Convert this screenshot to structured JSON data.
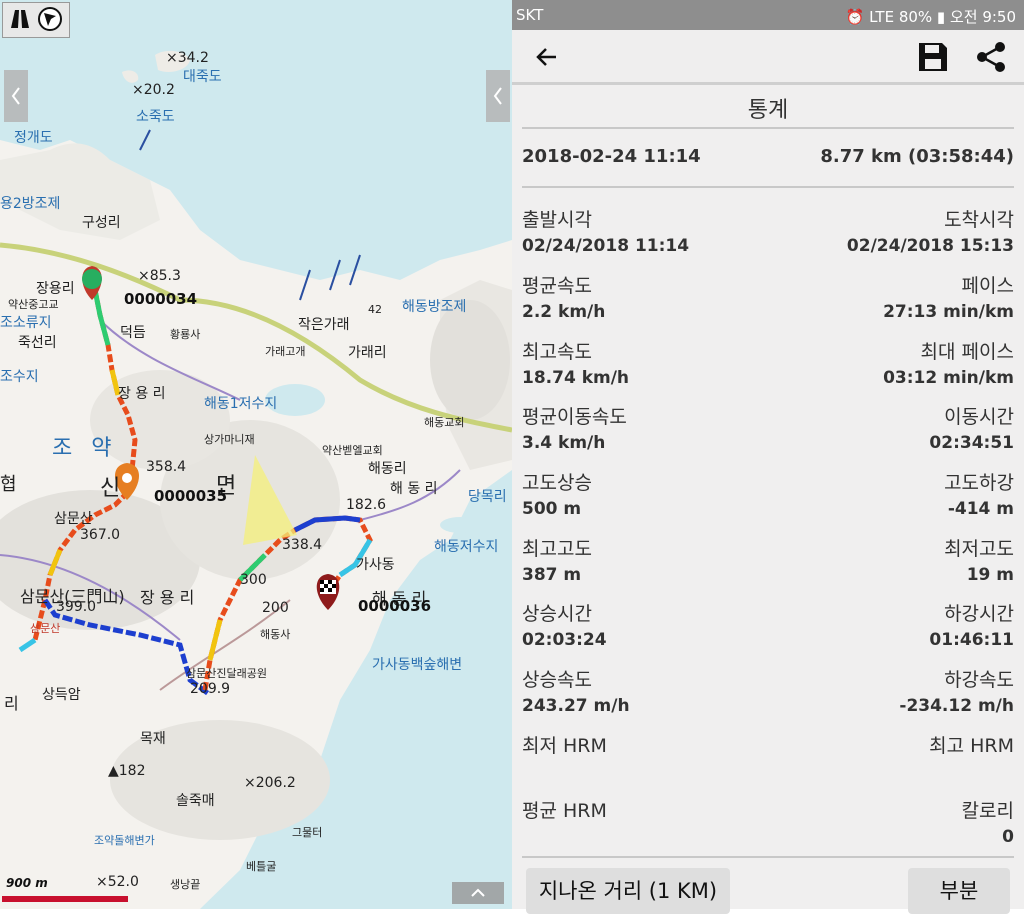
{
  "map": {
    "labels": {
      "l342": "×34.2",
      "daejukdo": "대죽도",
      "l202": "×20.2",
      "sojukdo": "소죽도",
      "jeonggaedo": "정개도",
      "yong2": "용2방조제",
      "guseongri": "구성리",
      "l853": "×85.3",
      "jangyongri": "장용리",
      "marker1": "0000034",
      "yaksanjung": "약산중고교",
      "soryuji": "조소류지",
      "juksunri": "죽선리",
      "deokdeum": "덕듬",
      "hwangyongsa": "황룡사",
      "l42": "42",
      "haedongbang": "해동방조제",
      "jakeungare": "작은가래",
      "garaegogae": "가래고개",
      "garaeri": "가래리",
      "suji": "조수지",
      "jangyongri2": "장 용 리",
      "haedong1": "해동1저수지",
      "haedonggyo": "해동교회",
      "joyak": "조 약",
      "sanggamani": "상가마니재",
      "yaksanbethel": "약산벧엘교회",
      "haedongri": "해동리",
      "haedongri2": "해 동 리",
      "l3584": "358.4",
      "sin": "신",
      "myeon": "면",
      "marker2": "0000035",
      "dangmok": "당목리",
      "l1826": "182.6",
      "sammunsan": "삼문산",
      "l3670": "367.0",
      "l3384": "338.4",
      "haedongsuji": "해동저수지",
      "gasadong": "가사동",
      "l300": "300",
      "sammunsan2": "삼문산(三門山)",
      "jangyongri3": "장 용 리",
      "l3990": "399.0",
      "haedongri3": "해 동 리",
      "marker3": "0000036",
      "l200": "200",
      "haedongsa": "해동사",
      "gasabaeksup": "가사동백숲해변",
      "sammun_park": "삼문산진달래공원",
      "l209": "209.9",
      "ri": "리",
      "sangdeugam": "상득암",
      "mokjae": "목재",
      "l182": "▲182",
      "solchukmae": "솔죽매",
      "l2062": "×206.2",
      "geulteo": "그물터",
      "joyakdol": "조약돌해변가",
      "betelgul": "베틀굴",
      "l520": "×52.0",
      "saengnang": "생낭끝",
      "hyeop": "협",
      "sammun_red": "삼문산"
    },
    "scale_label": "900 m"
  },
  "status": {
    "carrier": "SKT",
    "right": "⏰ LTE 80% ▮ 오전 9:50"
  },
  "title": "통계",
  "summary": {
    "date": "2018-02-24 11:14",
    "distance": "8.77 km (03:58:44)"
  },
  "stats": [
    {
      "left_label": "출발시각",
      "right_label": "도착시각",
      "left_value": "02/24/2018 11:14",
      "right_value": "02/24/2018 15:13"
    },
    {
      "left_label": "평균속도",
      "right_label": "페이스",
      "left_value": "2.2 km/h",
      "right_value": "27:13 min/km"
    },
    {
      "left_label": "최고속도",
      "right_label": "최대 페이스",
      "left_value": "18.74 km/h",
      "right_value": "03:12 min/km"
    },
    {
      "left_label": "평균이동속도",
      "right_label": "이동시간",
      "left_value": "3.4 km/h",
      "right_value": "02:34:51"
    },
    {
      "left_label": "고도상승",
      "right_label": "고도하강",
      "left_value": "500 m",
      "right_value": "-414 m"
    },
    {
      "left_label": "최고고도",
      "right_label": "최저고도",
      "left_value": "387 m",
      "right_value": "19 m"
    },
    {
      "left_label": "상승시간",
      "right_label": "하강시간",
      "left_value": "02:03:24",
      "right_value": "01:46:11"
    },
    {
      "left_label": "상승속도",
      "right_label": "하강속도",
      "left_value": "243.27 m/h",
      "right_value": "-234.12 m/h"
    },
    {
      "left_label": "최저 HRM",
      "right_label": "최고 HRM",
      "left_value": "",
      "right_value": ""
    },
    {
      "left_label": "평균 HRM",
      "right_label": "칼로리",
      "left_value": "",
      "right_value": "0"
    }
  ],
  "buttons": {
    "distance": "지나온 거리 (1  KM)",
    "partial": "부분"
  }
}
